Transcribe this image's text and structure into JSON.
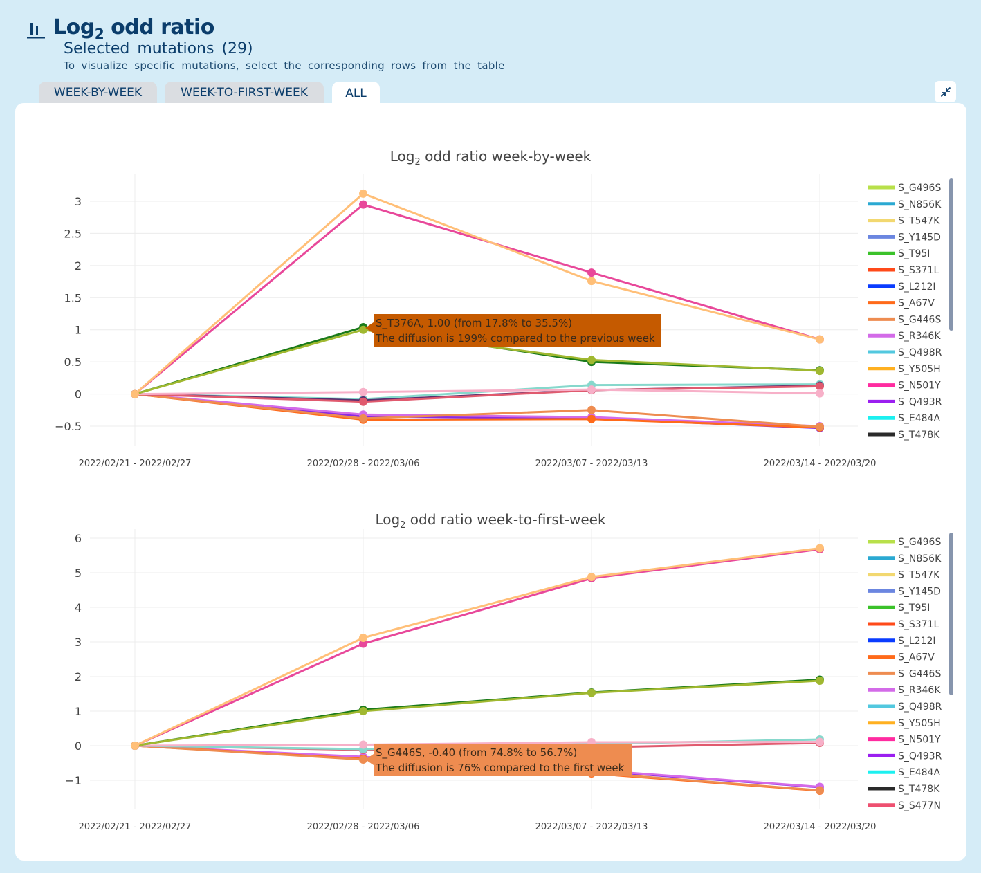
{
  "header": {
    "title": "Log",
    "title_sub": "2",
    "title_rest": " odd ratio",
    "subtitle": "Selected mutations (29)",
    "hint": "To visualize specific mutations, select the corresponding rows from the table"
  },
  "tabs": [
    {
      "label": "WEEK-BY-WEEK",
      "active": false
    },
    {
      "label": "WEEK-TO-FIRST-WEEK",
      "active": false
    },
    {
      "label": "ALL",
      "active": true
    }
  ],
  "icons": {
    "header": "bar-chart-icon",
    "collapse": "collapse-icon"
  },
  "legend_items": [
    "S_G496S",
    "S_N856K",
    "S_T547K",
    "S_Y145D",
    "S_T95I",
    "S_S371L",
    "S_L212I",
    "S_A67V",
    "S_G446S",
    "S_R346K",
    "S_Q498R",
    "S_Y505H",
    "S_N501Y",
    "S_Q493R",
    "S_E484A",
    "S_T478K",
    "S_S477N"
  ],
  "legend_colors": [
    "#b8e04a",
    "#2aa9d2",
    "#f2d870",
    "#6b86e0",
    "#3bc22a",
    "#ff4a1a",
    "#0a3cff",
    "#ff6a1a",
    "#ee8c50",
    "#d36be8",
    "#52c8df",
    "#ffb020",
    "#ff2ba0",
    "#9b1ff0",
    "#1cf0f0",
    "#2a2a2a",
    "#ee5070"
  ],
  "chart_data": [
    {
      "type": "line",
      "title": "Log",
      "title_sub": "2",
      "title_rest": " odd ratio week-by-week",
      "categories": [
        "2022/02/21 - 2022/02/27",
        "2022/02/28 - 2022/03/06",
        "2022/03/07 - 2022/03/13",
        "2022/03/14 - 2022/03/20"
      ],
      "ylim": [
        -0.7,
        3.4
      ],
      "yticks": [
        3,
        2.5,
        2,
        1.5,
        1,
        0.5,
        0,
        -0.5
      ],
      "ytick_labels": [
        "3",
        "2.5",
        "2",
        "1.5",
        "1",
        "0.5",
        "0",
        "−0.5"
      ],
      "grid": true,
      "legend_position": "right",
      "series": [
        {
          "color": "#ffbf78",
          "values": [
            0,
            3.12,
            1.76,
            0.85
          ]
        },
        {
          "color": "#e8489a",
          "values": [
            0,
            2.95,
            1.89,
            0.85
          ]
        },
        {
          "color": "#a0b830",
          "values": [
            0,
            1.0,
            0.53,
            0.36
          ]
        },
        {
          "color": "#1a7a1a",
          "values": [
            0,
            1.04,
            0.5,
            0.37
          ]
        },
        {
          "color": "#f7b0c8",
          "values": [
            0,
            0.03,
            0.07,
            0.01
          ]
        },
        {
          "color": "#e05a6e",
          "values": [
            0,
            -0.12,
            0.06,
            0.12
          ]
        },
        {
          "color": "#553070",
          "values": [
            0,
            -0.1,
            0.06,
            0.13
          ]
        },
        {
          "color": "#86d8cc",
          "values": [
            0,
            -0.08,
            0.14,
            0.15
          ]
        },
        {
          "color": "#ee8c50",
          "values": [
            0,
            -0.38,
            -0.25,
            -0.51
          ]
        },
        {
          "color": "#ff6a1a",
          "values": [
            0,
            -0.4,
            -0.39,
            -0.52
          ]
        },
        {
          "color": "#d36be8",
          "values": [
            0,
            -0.32,
            -0.36,
            -0.5
          ]
        },
        {
          "color": "#8a2be2",
          "values": [
            0,
            -0.35,
            -0.38,
            -0.53
          ]
        }
      ],
      "tooltip": {
        "label": "S_T376A, 1.00 (from 17.8% to 35.5%)",
        "detail": "The diffusion is 199% compared to the previous week",
        "color": "#c55a00",
        "anchor_category": 1,
        "anchor_value": 1.03
      }
    },
    {
      "type": "line",
      "title": "Log",
      "title_sub": "2",
      "title_rest": " odd ratio week-to-first-week",
      "categories": [
        "2022/02/21 - 2022/02/27",
        "2022/02/28 - 2022/03/06",
        "2022/03/07 - 2022/03/13",
        "2022/03/14 - 2022/03/20"
      ],
      "ylim": [
        -1.8,
        6.3
      ],
      "yticks": [
        6,
        5,
        4,
        3,
        2,
        1,
        0,
        -1
      ],
      "ytick_labels": [
        "6",
        "5",
        "4",
        "3",
        "2",
        "1",
        "0",
        "−1"
      ],
      "grid": true,
      "legend_position": "right",
      "series": [
        {
          "color": "#ffbf78",
          "values": [
            0,
            3.12,
            4.88,
            5.71
          ]
        },
        {
          "color": "#e8489a",
          "values": [
            0,
            2.95,
            4.84,
            5.68
          ]
        },
        {
          "color": "#a0b830",
          "values": [
            0,
            1.0,
            1.53,
            1.88
          ]
        },
        {
          "color": "#1a7a1a",
          "values": [
            0,
            1.04,
            1.54,
            1.91
          ]
        },
        {
          "color": "#f7b0c8",
          "values": [
            0,
            0.03,
            0.1,
            0.11
          ]
        },
        {
          "color": "#86d8cc",
          "values": [
            0,
            -0.1,
            0.05,
            0.18
          ]
        },
        {
          "color": "#e05a6e",
          "values": [
            0,
            -0.12,
            -0.05,
            0.08
          ]
        },
        {
          "color": "#ee8c50",
          "values": [
            0,
            -0.4,
            -0.78,
            -1.29
          ]
        },
        {
          "color": "#ff6a1a",
          "values": [
            0,
            -0.38,
            -0.8,
            -1.3
          ]
        },
        {
          "color": "#d36be8",
          "values": [
            0,
            -0.32,
            -0.7,
            -1.19
          ]
        },
        {
          "color": "#8a2be2",
          "values": [
            0,
            -0.35,
            -0.72,
            -1.2
          ]
        }
      ],
      "tooltip": {
        "label": "S_G446S, -0.40 (from 74.8% to 56.7%)",
        "detail": "The diffusion is 76% compared to the first week",
        "color": "#ee8c50",
        "anchor_category": 1,
        "anchor_value": -0.4
      }
    }
  ]
}
